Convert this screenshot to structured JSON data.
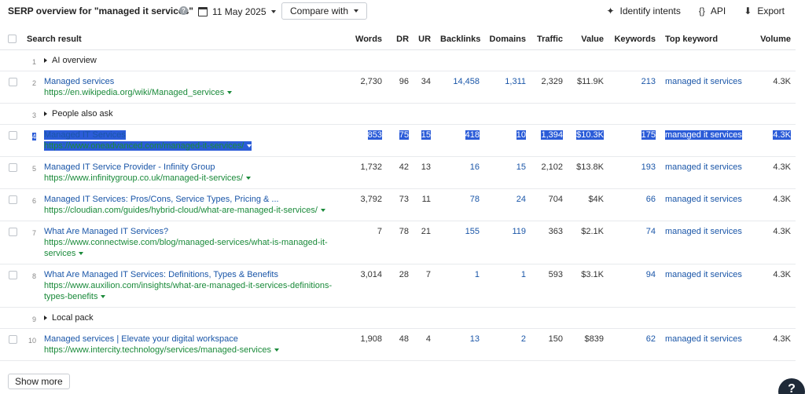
{
  "header": {
    "title": "SERP overview for \"managed it services\"",
    "date": "11 May 2025",
    "compare_label": "Compare with",
    "identify_label": "Identify intents",
    "api_label": "API",
    "export_label": "Export"
  },
  "columns": [
    "Search result",
    "Words",
    "DR",
    "UR",
    "Backlinks",
    "Domains",
    "Traffic",
    "Value",
    "Keywords",
    "Top keyword",
    "Volume"
  ],
  "rows": [
    {
      "type": "feature",
      "n": "1",
      "label": "AI overview"
    },
    {
      "type": "result",
      "n": "2",
      "title": "Managed services",
      "url": "https://en.wikipedia.org/wiki/Managed_services",
      "words": "2,730",
      "dr": "96",
      "ur": "34",
      "backlinks": "14,458",
      "domains": "1,311",
      "traffic": "2,329",
      "value": "$11.9K",
      "keywords": "213",
      "top": "managed it services",
      "volume": "4.3K"
    },
    {
      "type": "feature",
      "n": "3",
      "label": "People also ask"
    },
    {
      "type": "result",
      "n": "4",
      "title": "Managed IT Services",
      "url": "https://www.oneadvanced.com/managed-it-services/",
      "words": "853",
      "dr": "75",
      "ur": "15",
      "backlinks": "418",
      "domains": "10",
      "traffic": "1,394",
      "value": "$10.3K",
      "keywords": "175",
      "top": "managed it services",
      "volume": "4.3K",
      "highlight": true
    },
    {
      "type": "result",
      "n": "5",
      "title": "Managed IT Service Provider - Infinity Group",
      "url": "https://www.infinitygroup.co.uk/managed-it-services/",
      "words": "1,732",
      "dr": "42",
      "ur": "13",
      "backlinks": "16",
      "domains": "15",
      "traffic": "2,102",
      "value": "$13.8K",
      "keywords": "193",
      "top": "managed it services",
      "volume": "4.3K"
    },
    {
      "type": "result",
      "n": "6",
      "title": "Managed IT Services: Pros/Cons, Service Types, Pricing & ...",
      "url": "https://cloudian.com/guides/hybrid-cloud/what-are-managed-it-services/",
      "words": "3,792",
      "dr": "73",
      "ur": "11",
      "backlinks": "78",
      "domains": "24",
      "traffic": "704",
      "value": "$4K",
      "keywords": "66",
      "top": "managed it services",
      "volume": "4.3K"
    },
    {
      "type": "result",
      "n": "7",
      "title": "What Are Managed IT Services?",
      "url": "https://www.connectwise.com/blog/managed-services/what-is-managed-it-services",
      "words": "7",
      "dr": "78",
      "ur": "21",
      "backlinks": "155",
      "domains": "119",
      "traffic": "363",
      "value": "$2.1K",
      "keywords": "74",
      "top": "managed it services",
      "volume": "4.3K"
    },
    {
      "type": "result",
      "n": "8",
      "title": "What Are Managed IT Services: Definitions, Types & Benefits",
      "url": "https://www.auxilion.com/insights/what-are-managed-it-services-definitions-types-benefits",
      "words": "3,014",
      "dr": "28",
      "ur": "7",
      "backlinks": "1",
      "domains": "1",
      "traffic": "593",
      "value": "$3.1K",
      "keywords": "94",
      "top": "managed it services",
      "volume": "4.3K"
    },
    {
      "type": "feature",
      "n": "9",
      "label": "Local pack"
    },
    {
      "type": "result",
      "n": "10",
      "title": "Managed services | Elevate your digital workspace",
      "url": "https://www.intercity.technology/services/managed-services",
      "words": "1,908",
      "dr": "48",
      "ur": "4",
      "backlinks": "13",
      "domains": "2",
      "traffic": "150",
      "value": "$839",
      "keywords": "62",
      "top": "managed it services",
      "volume": "4.3K"
    }
  ],
  "footer": {
    "show_more": "Show more",
    "help": "?"
  }
}
